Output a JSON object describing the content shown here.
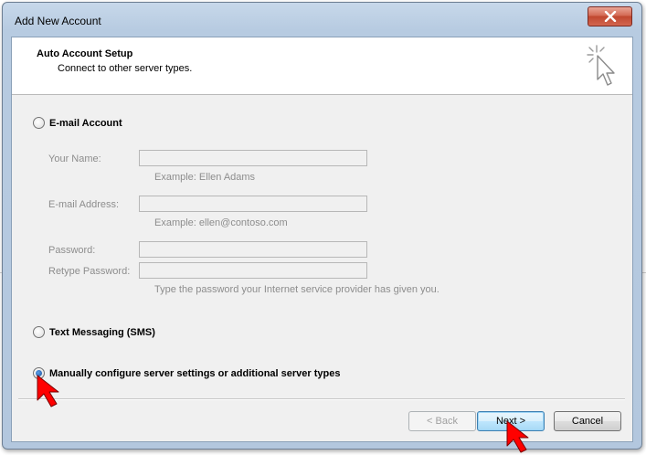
{
  "window": {
    "title": "Add New Account"
  },
  "header": {
    "title": "Auto Account Setup",
    "subtitle": "Connect to other server types."
  },
  "options": {
    "email_account": {
      "label": "E-mail Account",
      "checked": false
    },
    "sms": {
      "label": "Text Messaging (SMS)",
      "checked": false
    },
    "manual": {
      "label": "Manually configure server settings or additional server types",
      "checked": true
    }
  },
  "fields": {
    "your_name": {
      "label": "Your Name:",
      "value": "",
      "hint": "Example: Ellen Adams"
    },
    "email": {
      "label": "E-mail Address:",
      "value": "",
      "hint": "Example: ellen@contoso.com"
    },
    "password": {
      "label": "Password:",
      "value": ""
    },
    "retype_password": {
      "label": "Retype Password:",
      "value": "",
      "hint": "Type the password your Internet service provider has given you."
    }
  },
  "buttons": {
    "back": "< Back",
    "next": "Next >",
    "cancel": "Cancel"
  },
  "colors": {
    "annotation_arrow": "#ff0000",
    "close_button": "#c7503a"
  }
}
